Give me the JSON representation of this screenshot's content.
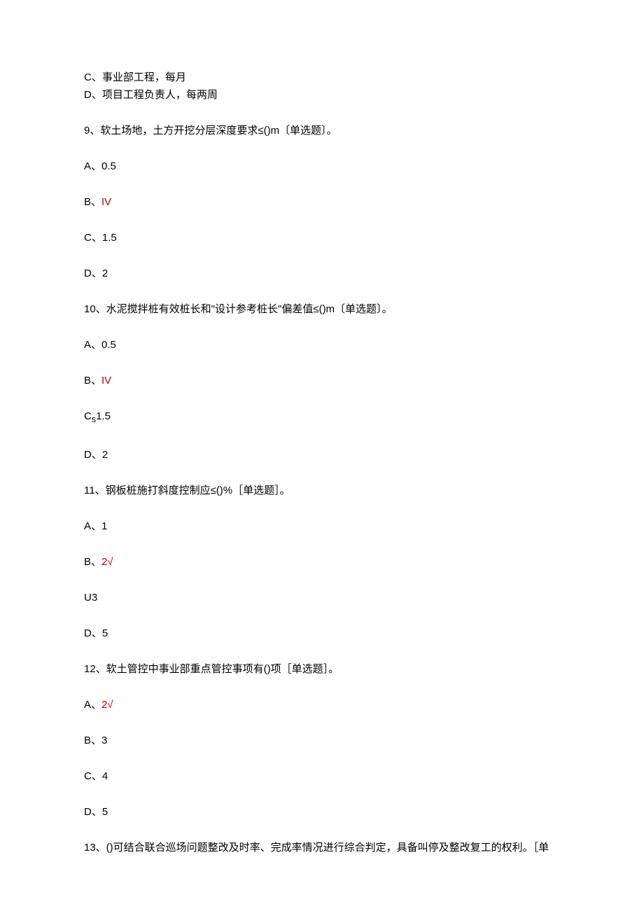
{
  "q8_options": {
    "c": "C、事业部工程，每月",
    "d": "D、项目工程负责人，每两周"
  },
  "q9": {
    "stem": "9、软土场地，土方开挖分层深度要求≤()m〔单选题〕。",
    "a": "A、0.5",
    "b_prefix": "B、",
    "b_highlight": "IV",
    "c": "C、1.5",
    "d": "D、2"
  },
  "q10": {
    "stem": "10、水泥搅拌桩有效桩长和\"设计参考桩长\"偏差值≤()m〔单选题〕。",
    "a": "A、0.5",
    "b_prefix": "B、",
    "b_highlight": "IV",
    "c_prefix": "C",
    "c_sub": "s",
    "c_rest": "1.5",
    "d": "D、2"
  },
  "q11": {
    "stem": "11、钢板桩施打斜度控制应≤()%［单选题］。",
    "a": "A、1",
    "b_prefix": "B、",
    "b_highlight": "2√",
    "c": "U3",
    "d": "D、5"
  },
  "q12": {
    "stem": "12、软土管控中事业部重点管控事项有()项［单选题］。",
    "a_prefix": "A、",
    "a_highlight": "2√",
    "b": "B、3",
    "c": "C、4",
    "d": "D、5"
  },
  "q13": {
    "stem": "13、()可结合联合巡场问题整改及时率、完成率情况进行综合判定，具备叫停及整改复工的权利。［单"
  }
}
